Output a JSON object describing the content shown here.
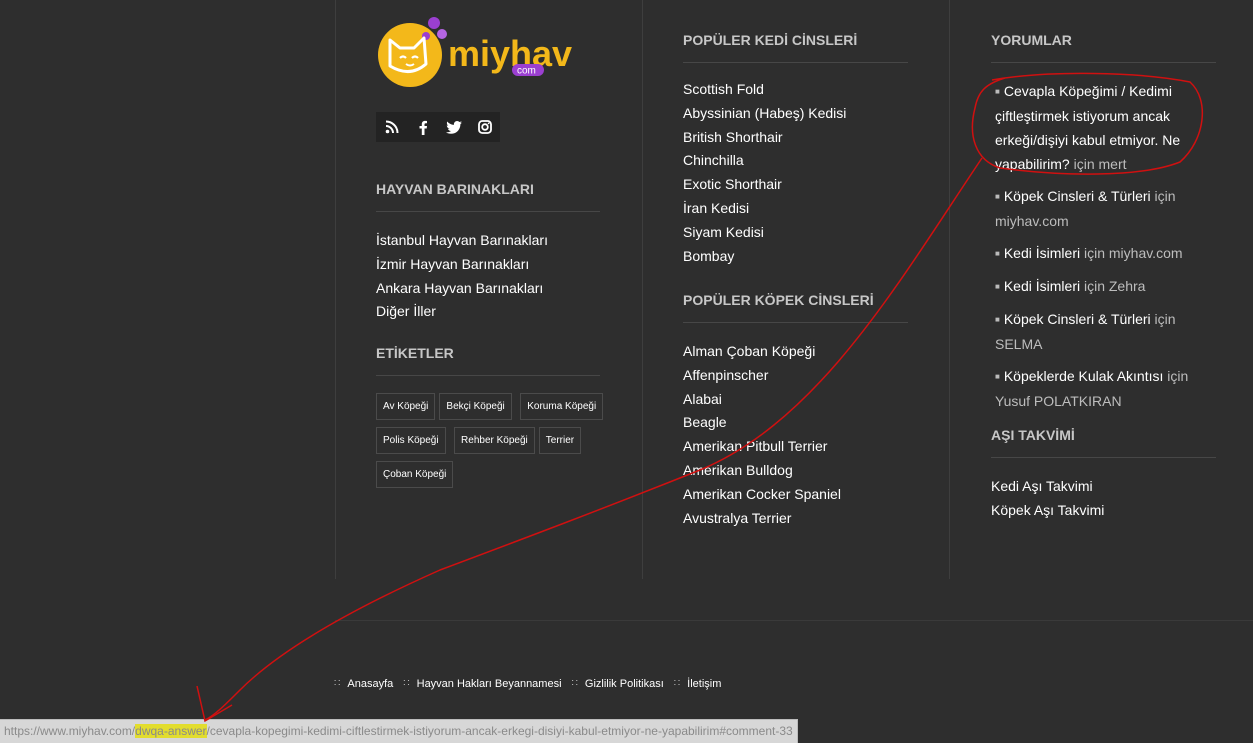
{
  "logo": {
    "text": "miyhav",
    "sub": "com"
  },
  "social": {
    "icons": [
      "rss-icon",
      "facebook-icon",
      "twitter-icon",
      "instagram-icon"
    ]
  },
  "shelters": {
    "title": "HAYVAN BARINAKLARI",
    "links": [
      "İstanbul Hayvan Barınakları",
      "İzmir Hayvan Barınakları",
      "Ankara Hayvan Barınakları",
      "Diğer İller"
    ]
  },
  "tags": {
    "title": "ETİKETLER",
    "items": [
      "Av Köpeği",
      "Bekçi Köpeği",
      "Koruma Köpeği",
      "Polis Köpeği",
      "Rehber Köpeği",
      "Terrier",
      "Çoban Köpeği"
    ]
  },
  "cats": {
    "title": "POPÜLER KEDİ CİNSLERİ",
    "links": [
      "Scottish Fold",
      "Abyssinian (Habeş) Kedisi",
      "British Shorthair",
      "Chinchilla",
      "Exotic Shorthair",
      "İran Kedisi",
      "Siyam Kedisi",
      "Bombay"
    ]
  },
  "dogs": {
    "title": "POPÜLER KÖPEK CİNSLERİ",
    "links": [
      "Alman Çoban Köpeği",
      "Affenpinscher",
      "Alabai",
      "Beagle",
      "Amerikan Pitbull Terrier",
      "Amerikan Bulldog",
      "Amerikan Cocker Spaniel",
      "Avustralya Terrier"
    ]
  },
  "comments": {
    "title": "YORUMLAR",
    "items": [
      {
        "post": "Cevapla Köpeğimi / Kedimi çiftleştirmek istiyorum ancak erkeği/dişiyi kabul etmiyor. Ne yapabilirim?",
        "by": "için mert"
      },
      {
        "post": "Köpek Cinsleri & Türleri",
        "by": "için miyhav.com"
      },
      {
        "post": "Kedi İsimleri",
        "by": "için miyhav.com"
      },
      {
        "post": "Kedi İsimleri",
        "by": "için Zehra"
      },
      {
        "post": "Köpek Cinsleri & Türleri",
        "by": "için SELMA"
      },
      {
        "post": "Köpeklerde Kulak Akıntısı",
        "by": "için Yusuf POLATKIRAN"
      }
    ]
  },
  "vaccine": {
    "title": "AŞI TAKVİMİ",
    "links": [
      "Kedi Aşı Takvimi",
      "Köpek Aşı Takvimi"
    ]
  },
  "footer": {
    "links": [
      "Anasayfa",
      "Hayvan Hakları Beyannamesi",
      "Gizlilik Politikası",
      "İletişim"
    ]
  },
  "status_bar": {
    "prefix": "https://www.miyhav.com/",
    "highlight": "dwqa-answer",
    "suffix": "/cevapla-kopegimi-kedimi-ciftlestirmek-istiyorum-ancak-erkegi-disiyi-kabul-etmiyor-ne-yapabilirim#comment-33"
  },
  "colors": {
    "annotation": "#d01010",
    "highlight": "#e2dd2e",
    "logo_orange": "#f3b81a",
    "logo_purple": "#9b3fd1"
  }
}
